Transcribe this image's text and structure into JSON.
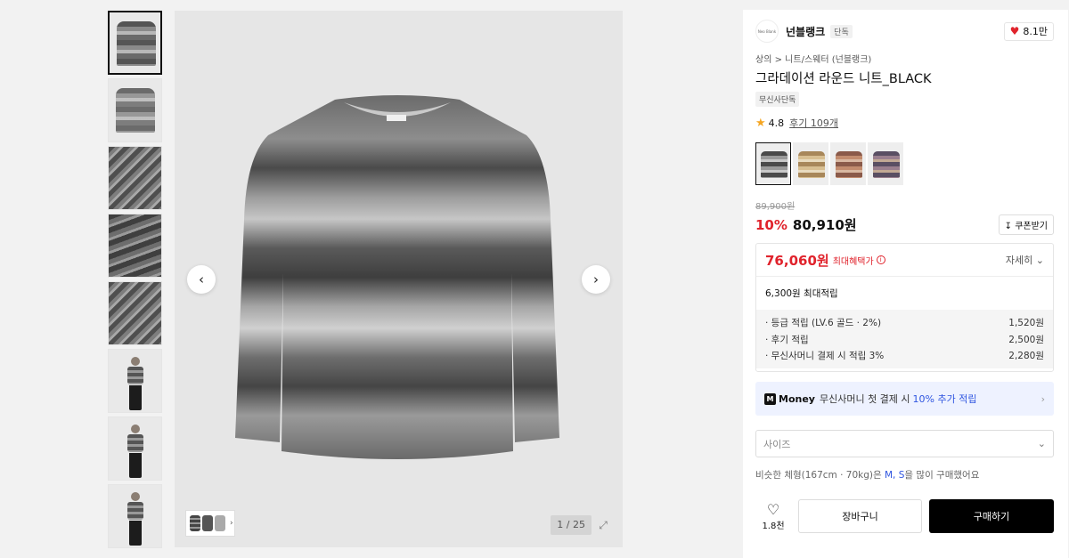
{
  "gallery": {
    "counter": "1 / 25",
    "prev_icon": "chevron-left-icon",
    "next_icon": "chevron-right-icon",
    "expand_icon": "expand-icon",
    "thumbnail_count": 8
  },
  "brand": {
    "logo_text": "Neo Blank",
    "name": "넌블랭크",
    "badge": "단독",
    "likes": "8.1만",
    "heart_color": "#e0232c"
  },
  "breadcrumb": {
    "level1": "상의",
    "separator": ">",
    "level2": "니트/스웨터 (넌블랭크)"
  },
  "product": {
    "title": "그라데이션 라운드 니트_BLACK",
    "exclusive_badge": "무신사단독",
    "rating": "4.8",
    "reviews": "후기 109개"
  },
  "price": {
    "original": "89,900원",
    "discount": "10%",
    "current": "80,910원",
    "coupon_label": "쿠폰받기",
    "coupon_icon": "download-icon"
  },
  "benefit": {
    "max_price": "76,060원",
    "max_label": "최대혜택가",
    "detail_label": "자세히",
    "points_title": "6,300원 최대적립",
    "points": [
      {
        "label": "· 등급 적립 (LV.6 골드 · 2%)",
        "value": "1,520원"
      },
      {
        "label": "· 후기 적립",
        "value": "2,500원"
      },
      {
        "label": "· 무신사머니 결제 시 적립 3%",
        "value": "2,280원"
      }
    ]
  },
  "money": {
    "icon": "M",
    "brand": "Money",
    "text": "무신사머니 첫 결제 시",
    "highlight": "10% 추가 적립",
    "accent": "#2f55e0"
  },
  "size": {
    "placeholder": "사이즈"
  },
  "similar": {
    "prefix": "비슷한 체형(167cm · 70kg)은",
    "sizes": "M, S",
    "suffix": "을 많이 구매했어요"
  },
  "actions": {
    "wish_count": "1.8천",
    "cart": "장바구니",
    "buy": "구매하기"
  }
}
